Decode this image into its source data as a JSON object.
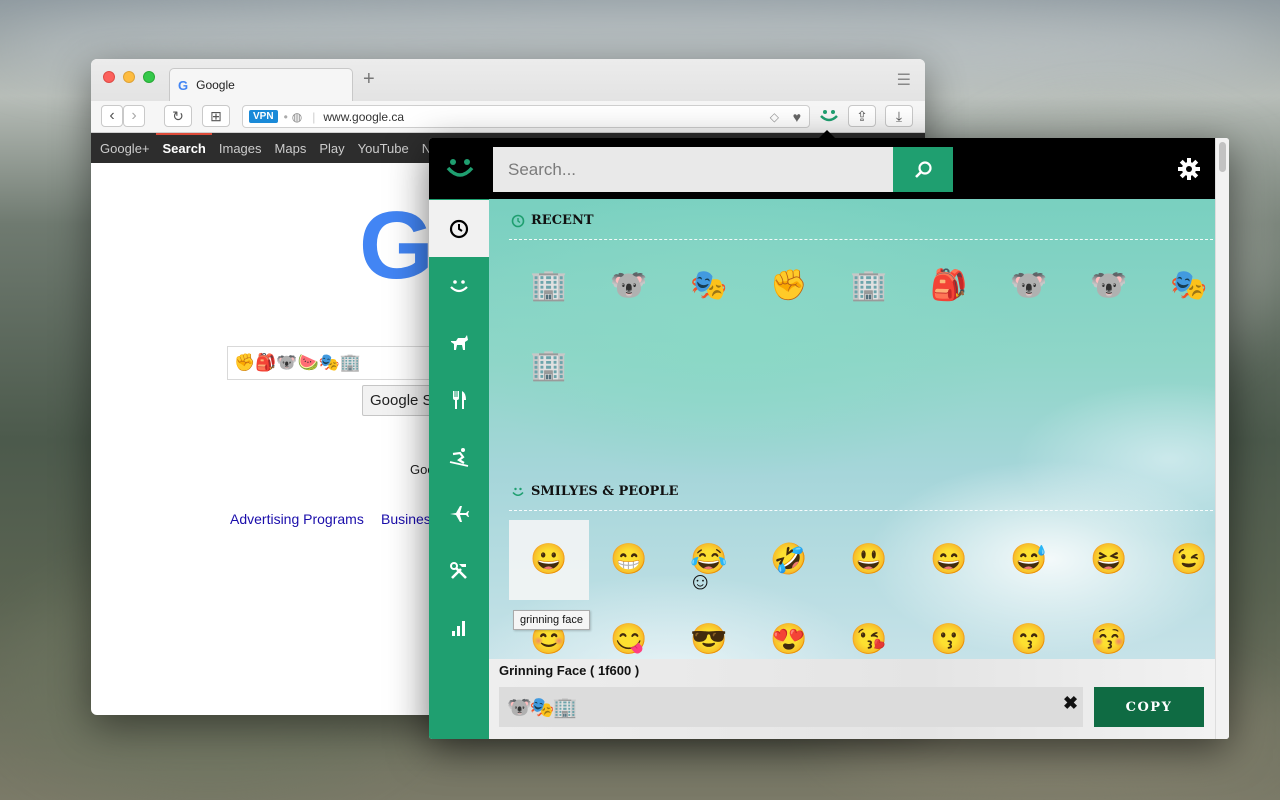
{
  "browser": {
    "tab_title": "Google",
    "tab_favicon": "G",
    "new_tab_symbol": "+",
    "url": "www.google.ca",
    "vpn_badge": "VPN",
    "nav_back": "‹",
    "nav_forward": "›",
    "reload": "↻",
    "grid": "⊞",
    "shield": "◇",
    "heart": "♥",
    "share": "⇪",
    "download": "⤓"
  },
  "google": {
    "nav_items": [
      "Google+",
      "Search",
      "Images",
      "Maps",
      "Play",
      "YouTube",
      "Ne"
    ],
    "active_nav": "Search",
    "logo": "G",
    "search_value": "✊🎒🐨🍉🎭🏢",
    "search_button": "Google S",
    "offered_in": "Goo",
    "links": [
      "Advertising Programs",
      "Busines"
    ]
  },
  "popup": {
    "search_placeholder": "Search...",
    "icons": {
      "logo": "smiley-logo-icon",
      "search_button": "search-icon",
      "settings": "gear-icon"
    },
    "sidebar": [
      {
        "name": "recent",
        "icon": "clock-icon",
        "active": true
      },
      {
        "name": "smileys",
        "icon": "smiley-icon",
        "active": false
      },
      {
        "name": "animals",
        "icon": "dog-icon",
        "active": false
      },
      {
        "name": "food",
        "icon": "fork-knife-icon",
        "active": false
      },
      {
        "name": "activities",
        "icon": "skier-icon",
        "active": false
      },
      {
        "name": "travel",
        "icon": "airplane-icon",
        "active": false
      },
      {
        "name": "objects",
        "icon": "tools-icon",
        "active": false
      },
      {
        "name": "symbols",
        "icon": "bar-chart-icon",
        "active": false
      }
    ],
    "recent_heading": "RECENT",
    "recent_emojis": [
      "🏢",
      "🐨",
      "🎭",
      "✊",
      "🏢",
      "🎒",
      "🐨",
      "🐨",
      "🎭",
      "🏢"
    ],
    "smileys_heading": "SMILYES & PEOPLE",
    "smileys_row1": [
      "😀",
      "😁",
      "😂",
      "🤣",
      "😃",
      "😄",
      "😅",
      "😆",
      "😉"
    ],
    "smileys_row2": [
      "😊",
      "😋",
      "😎",
      "😍",
      "😘",
      "😗",
      "😙",
      "😚"
    ],
    "tooltip": "grinning face",
    "selected_name": "Grinning Face ( 1f600 )",
    "output_value": "🐨🎭🏢",
    "clear_symbol": "✖",
    "copy_label": "COPY",
    "floating_smiley": "☺",
    "colors": {
      "accent": "#1f9f70",
      "copy_button": "#0f6b43",
      "header": "#000000"
    }
  }
}
